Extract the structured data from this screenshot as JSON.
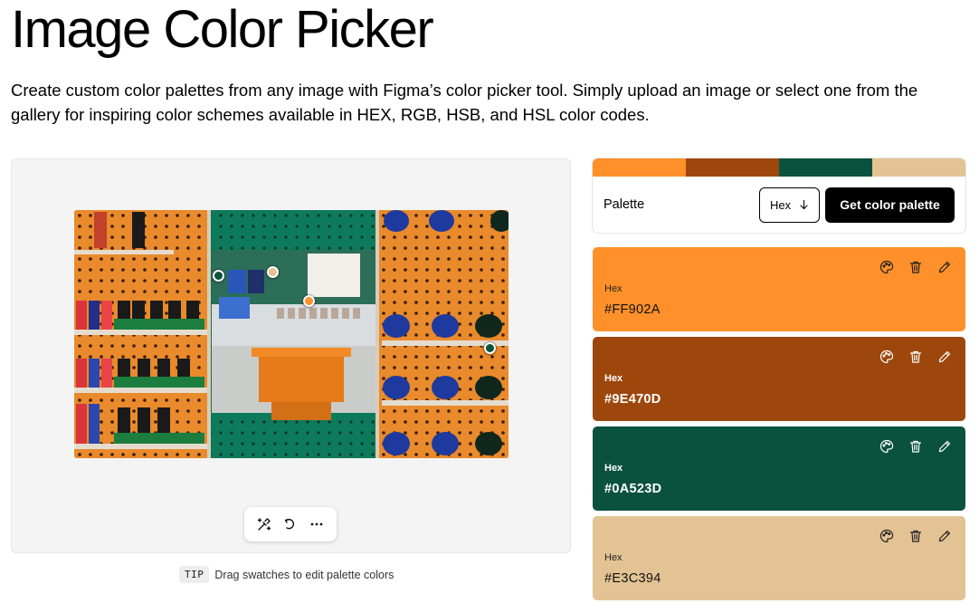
{
  "page": {
    "title": "Image Color Picker",
    "description": "Create custom color palettes from any image with Figma’s color picker tool. Simply upload an image or select one from the gallery for inspiring color schemes available in HEX, RGB, HSB, and HSL color codes."
  },
  "toolbar": {
    "icons": [
      "eyedropper-sparkle-icon",
      "undo-icon",
      "more-icon"
    ]
  },
  "tip": {
    "badge": "TIP",
    "text": "Drag swatches to edit palette colors"
  },
  "palette": {
    "label": "Palette",
    "format": "Hex",
    "button": "Get color palette",
    "strip": [
      "#FF902A",
      "#9E470D",
      "#0A523D",
      "#E3C394"
    ]
  },
  "colors": [
    {
      "label": "Hex",
      "value": "#FF902A",
      "bg": "#FF902A"
    },
    {
      "label": "Hex",
      "value": "#9E470D",
      "bg": "#9E470D"
    },
    {
      "label": "Hex",
      "value": "#0A523D",
      "bg": "#0A523D"
    },
    {
      "label": "Hex",
      "value": "#E3C394",
      "bg": "#E3C394"
    }
  ]
}
